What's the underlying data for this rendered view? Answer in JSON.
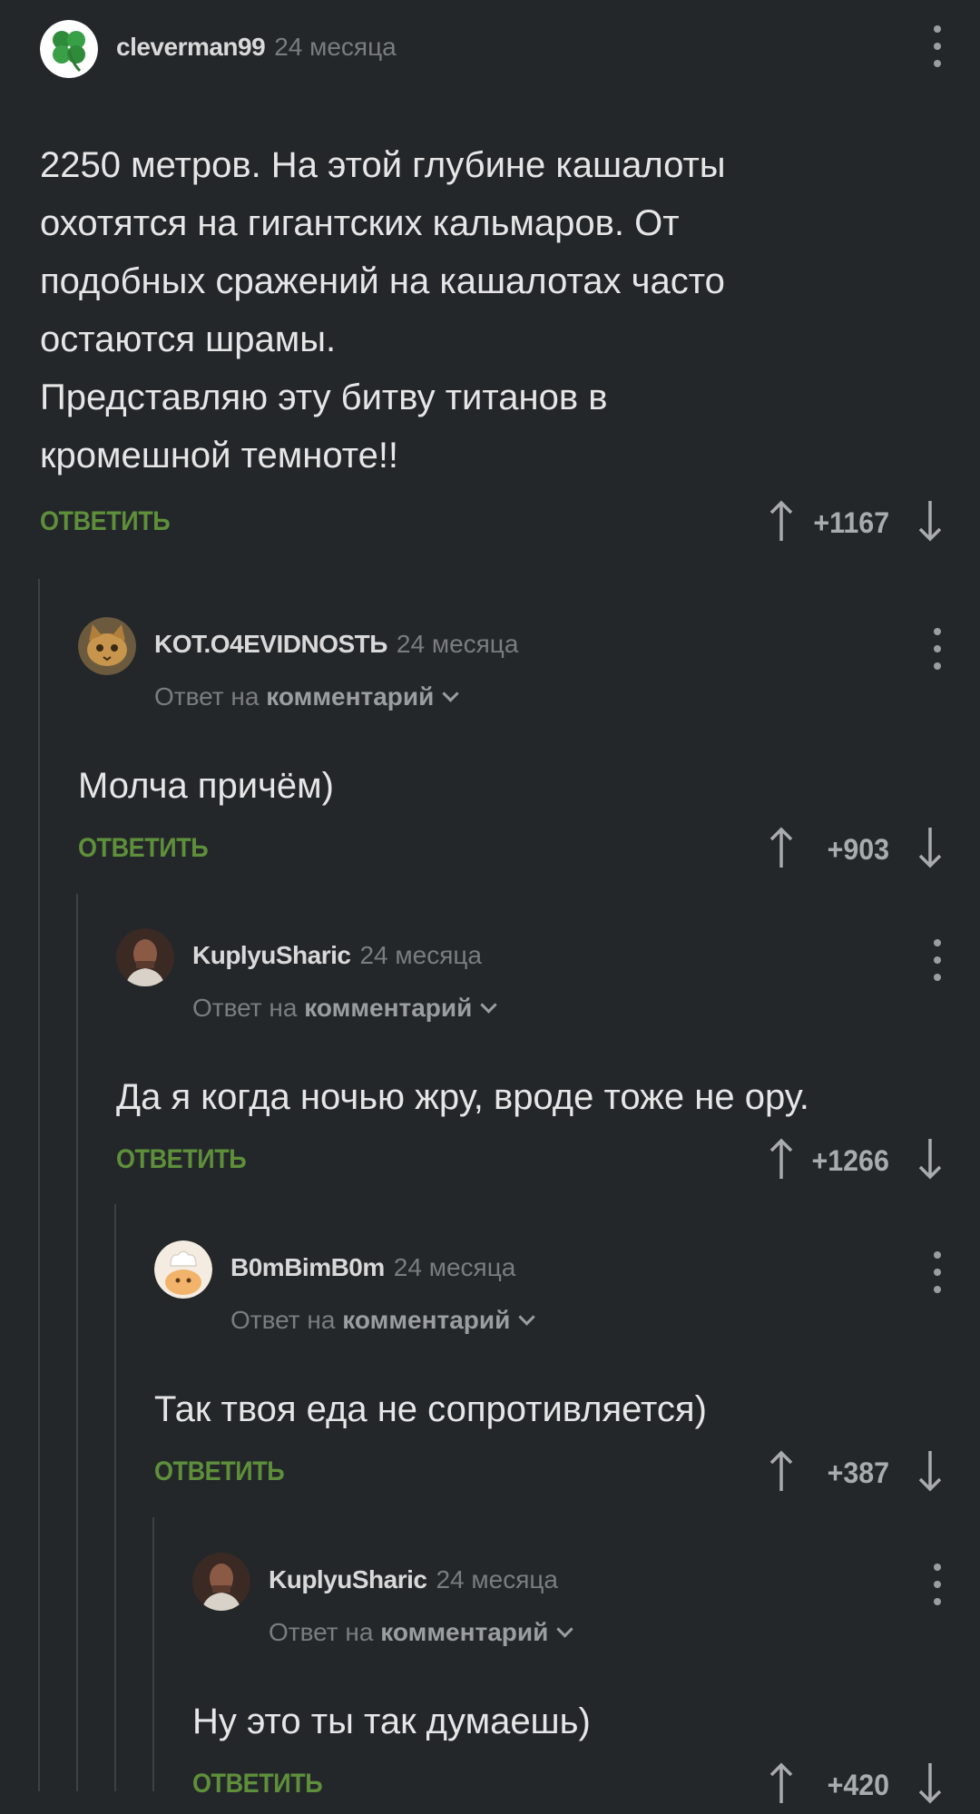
{
  "comments": [
    {
      "author": "cleverman99",
      "time": "24 месяца",
      "body_lines": [
        "2250 метров. На этой глубине кашалоты",
        "охотятся на гигантских кальмаров. От",
        "подобных сражений на кашалотах часто",
        "остаются шрамы.",
        "Представляю эту битву титанов в",
        "кромешной темноте!!"
      ],
      "reply_label": "ОТВЕТИТЬ",
      "rating": "+1167"
    },
    {
      "author": "KOT.O4EVIDNOSTЬ",
      "time": "24 месяца",
      "reply_to_prefix": "Ответ на",
      "reply_to_link": "комментарий",
      "body_lines": [
        "Молча причём)"
      ],
      "reply_label": "ОТВЕТИТЬ",
      "rating": "+903"
    },
    {
      "author": "KuplyuSharic",
      "time": "24 месяца",
      "reply_to_prefix": "Ответ на",
      "reply_to_link": "комментарий",
      "body_lines": [
        "Да я когда ночью жру, вроде тоже не ору."
      ],
      "reply_label": "ОТВЕТИТЬ",
      "rating": "+1266"
    },
    {
      "author": "B0mBimB0m",
      "time": "24 месяца",
      "reply_to_prefix": "Ответ на",
      "reply_to_link": "комментарий",
      "body_lines": [
        "Так твоя еда не сопротивляется)"
      ],
      "reply_label": "ОТВЕТИТЬ",
      "rating": "+387"
    },
    {
      "author": "KuplyuSharic",
      "time": "24 месяца",
      "reply_to_prefix": "Ответ на",
      "reply_to_link": "комментарий",
      "body_lines": [
        "Ну это ты так думаешь)"
      ],
      "reply_label": "ОТВЕТИТЬ",
      "rating": "+420"
    }
  ],
  "icons": {
    "avatar_0": "clover-avatar",
    "avatar_1": "cat-avatar",
    "avatar_2": "man-photo-avatar",
    "avatar_3": "chef-emoji-avatar",
    "avatar_4": "man-photo-avatar",
    "menu": "more-vertical-icon",
    "upvote": "arrow-up-icon",
    "downvote": "arrow-down-icon",
    "reply_expand": "chevron-down-icon"
  },
  "colors": {
    "background": "#24272a",
    "reply_button": "#5e8f3a",
    "text": "#e6e6e6",
    "muted": "#7a7d80",
    "thread_line": "#3d4044"
  }
}
